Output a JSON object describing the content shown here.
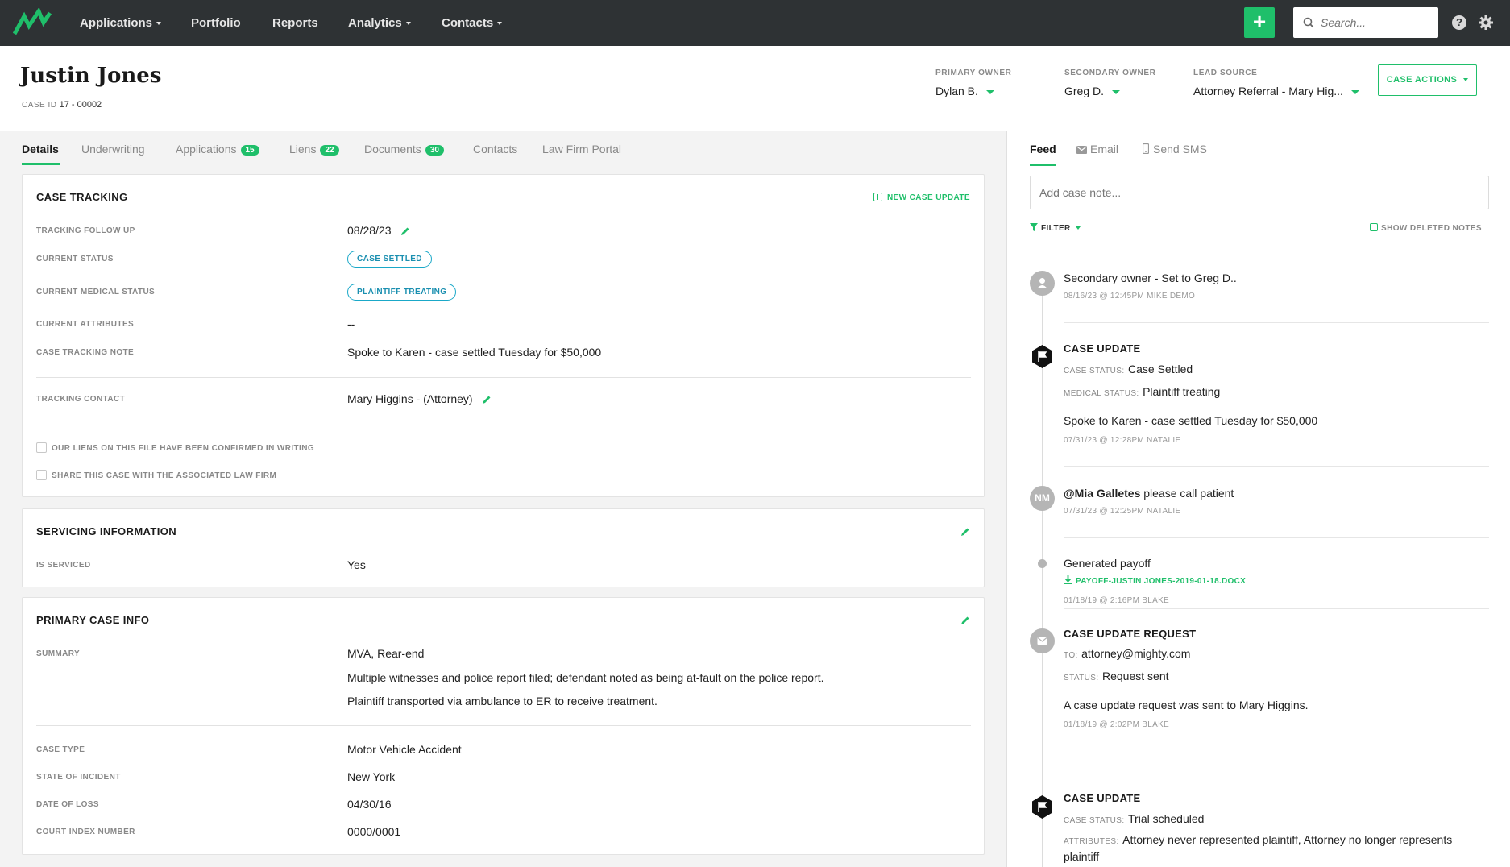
{
  "nav": {
    "items": [
      {
        "label": "Applications",
        "caret": true
      },
      {
        "label": "Portfolio",
        "caret": false
      },
      {
        "label": "Reports",
        "caret": false
      },
      {
        "label": "Analytics",
        "caret": true
      },
      {
        "label": "Contacts",
        "caret": true
      }
    ],
    "plus_label": "+",
    "search_placeholder": "Search...",
    "help_label": "?"
  },
  "header": {
    "name": "Justin Jones",
    "case_id_label": "CASE ID",
    "case_id_value": "17 - 00002",
    "primary_owner": {
      "label": "PRIMARY OWNER",
      "value": "Dylan B."
    },
    "secondary_owner": {
      "label": "SECONDARY OWNER",
      "value": "Greg D."
    },
    "lead_source": {
      "label": "LEAD SOURCE",
      "value": "Attorney Referral - Mary Hig..."
    },
    "case_actions": "CASE ACTIONS"
  },
  "tabs": [
    {
      "label": "Details",
      "badge": ""
    },
    {
      "label": "Underwriting",
      "badge": ""
    },
    {
      "label": "Applications",
      "badge": "15"
    },
    {
      "label": "Liens",
      "badge": "22"
    },
    {
      "label": "Documents",
      "badge": "30"
    },
    {
      "label": "Contacts",
      "badge": ""
    },
    {
      "label": "Law Firm Portal",
      "badge": ""
    }
  ],
  "case_tracking": {
    "title": "CASE TRACKING",
    "new_update": "NEW CASE UPDATE",
    "follow_up_label": "TRACKING FOLLOW UP",
    "follow_up_value": "08/28/23",
    "status_label": "CURRENT STATUS",
    "status_value": "CASE SETTLED",
    "medical_label": "CURRENT MEDICAL STATUS",
    "medical_value": "PLAINTIFF TREATING",
    "attributes_label": "CURRENT ATTRIBUTES",
    "attributes_value": "--",
    "note_label": "CASE TRACKING NOTE",
    "note_value": "Spoke to Karen - case settled Tuesday for $50,000",
    "contact_label": "TRACKING CONTACT",
    "contact_value": "Mary Higgins - (Attorney)",
    "checkbox_liens": "OUR LIENS ON THIS FILE HAVE BEEN CONFIRMED IN WRITING",
    "checkbox_share": "SHARE THIS CASE WITH THE ASSOCIATED LAW FIRM"
  },
  "servicing": {
    "title": "SERVICING INFORMATION",
    "serviced_label": "IS SERVICED",
    "serviced_value": "Yes"
  },
  "primary_info": {
    "title": "PRIMARY CASE INFO",
    "summary_label": "SUMMARY",
    "summary_lines": [
      "MVA, Rear-end",
      "Multiple witnesses and police report filed; defendant noted as being at-fault on the police report.",
      "Plaintiff transported via ambulance to ER to receive treatment."
    ],
    "case_type_label": "CASE TYPE",
    "case_type_value": "Motor Vehicle Accident",
    "state_label": "STATE OF INCIDENT",
    "state_value": "New York",
    "loss_label": "DATE OF LOSS",
    "loss_value": "04/30/16",
    "index_label": "COURT INDEX NUMBER",
    "index_value": "0000/0001"
  },
  "feed": {
    "tabs": {
      "feed": "Feed",
      "email": "Email",
      "sms": "Send SMS"
    },
    "note_placeholder": "Add case note...",
    "filter": "FILTER",
    "show_deleted": "SHOW DELETED NOTES",
    "entries": {
      "e1": {
        "text": "Secondary owner - Set to Greg D..",
        "meta": "08/16/23 @ 12:45PM MIKE DEMO"
      },
      "e2": {
        "title": "CASE UPDATE",
        "status_lbl": "CASE STATUS:",
        "status_val": "Case Settled",
        "medical_lbl": "MEDICAL STATUS:",
        "medical_val": "Plaintiff treating",
        "text": "Spoke to Karen - case settled Tuesday for $50,000",
        "meta": "07/31/23 @ 12:28PM NATALIE"
      },
      "e3": {
        "initials": "NM",
        "mention": "@Mia Galletes",
        "text": " please call patient",
        "meta": "07/31/23 @ 12:25PM NATALIE"
      },
      "e4": {
        "text": "Generated payoff",
        "link": "PAYOFF-JUSTIN JONES-2019-01-18.DOCX",
        "meta": "01/18/19 @ 2:16PM BLAKE"
      },
      "e5": {
        "title": "CASE UPDATE REQUEST",
        "to_lbl": "TO:",
        "to_val": "attorney@mighty.com",
        "status_lbl": "STATUS:",
        "status_val": "Request sent",
        "text": "A case update request was sent to Mary Higgins.",
        "meta": "01/18/19 @ 2:02PM BLAKE"
      },
      "e6": {
        "title": "CASE UPDATE",
        "status_lbl": "CASE STATUS:",
        "status_val": "Trial scheduled",
        "attr_lbl": "ATTRIBUTES:",
        "attr_val": "Attorney never represented plaintiff, Attorney no longer represents plaintiff"
      }
    }
  },
  "colors": {
    "accent": "#1fbf6a",
    "nav_bg": "#2e3234",
    "pill": "#1aa8c8"
  }
}
